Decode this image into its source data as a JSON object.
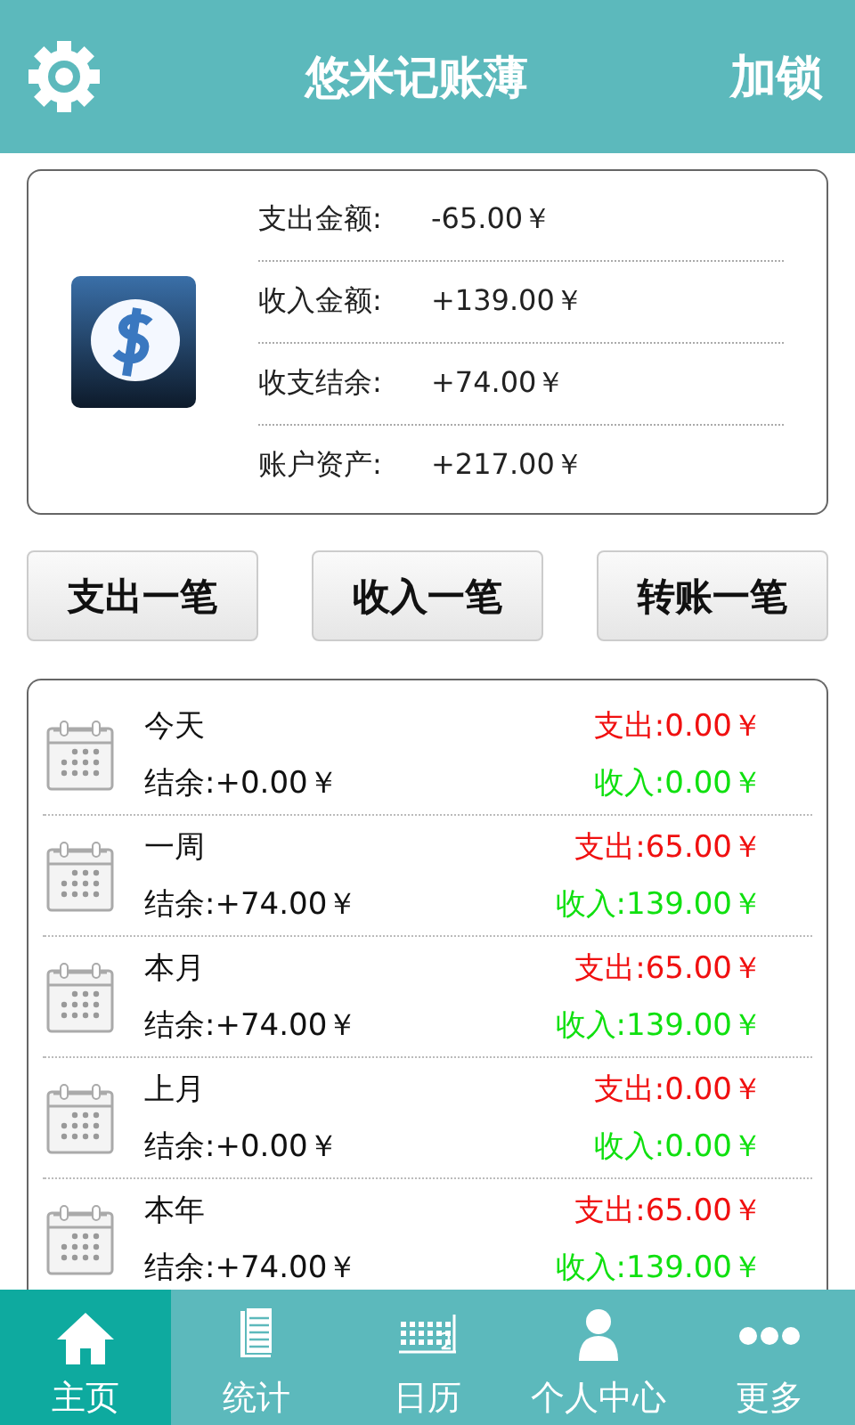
{
  "header": {
    "title": "悠米记账薄",
    "action": "加锁"
  },
  "summary": [
    {
      "label": "支出金额:",
      "value": "-65.00￥"
    },
    {
      "label": "收入金额:",
      "value": "+139.00￥"
    },
    {
      "label": "收支结余:",
      "value": "+74.00￥"
    },
    {
      "label": "账户资产:",
      "value": "+217.00￥"
    }
  ],
  "buttons": [
    "支出一笔",
    "收入一笔",
    "转账一笔"
  ],
  "periods": [
    {
      "name": "今天",
      "balance": "结余:+0.00￥",
      "expense": "支出:0.00￥",
      "income": "收入:0.00￥"
    },
    {
      "name": "一周",
      "balance": "结余:+74.00￥",
      "expense": "支出:65.00￥",
      "income": "收入:139.00￥"
    },
    {
      "name": "本月",
      "balance": "结余:+74.00￥",
      "expense": "支出:65.00￥",
      "income": "收入:139.00￥"
    },
    {
      "name": "上月",
      "balance": "结余:+0.00￥",
      "expense": "支出:0.00￥",
      "income": "收入:0.00￥"
    },
    {
      "name": "本年",
      "balance": "结余:+74.00￥",
      "expense": "支出:65.00￥",
      "income": "收入:139.00￥"
    }
  ],
  "tabs": [
    {
      "label": "主页",
      "kind": "home",
      "selected": true
    },
    {
      "label": "统计",
      "kind": "report",
      "selected": false
    },
    {
      "label": "日历",
      "kind": "calendar",
      "selected": false
    },
    {
      "label": "个人中心",
      "kind": "person",
      "selected": false
    },
    {
      "label": "更多",
      "kind": "more",
      "selected": false
    }
  ]
}
